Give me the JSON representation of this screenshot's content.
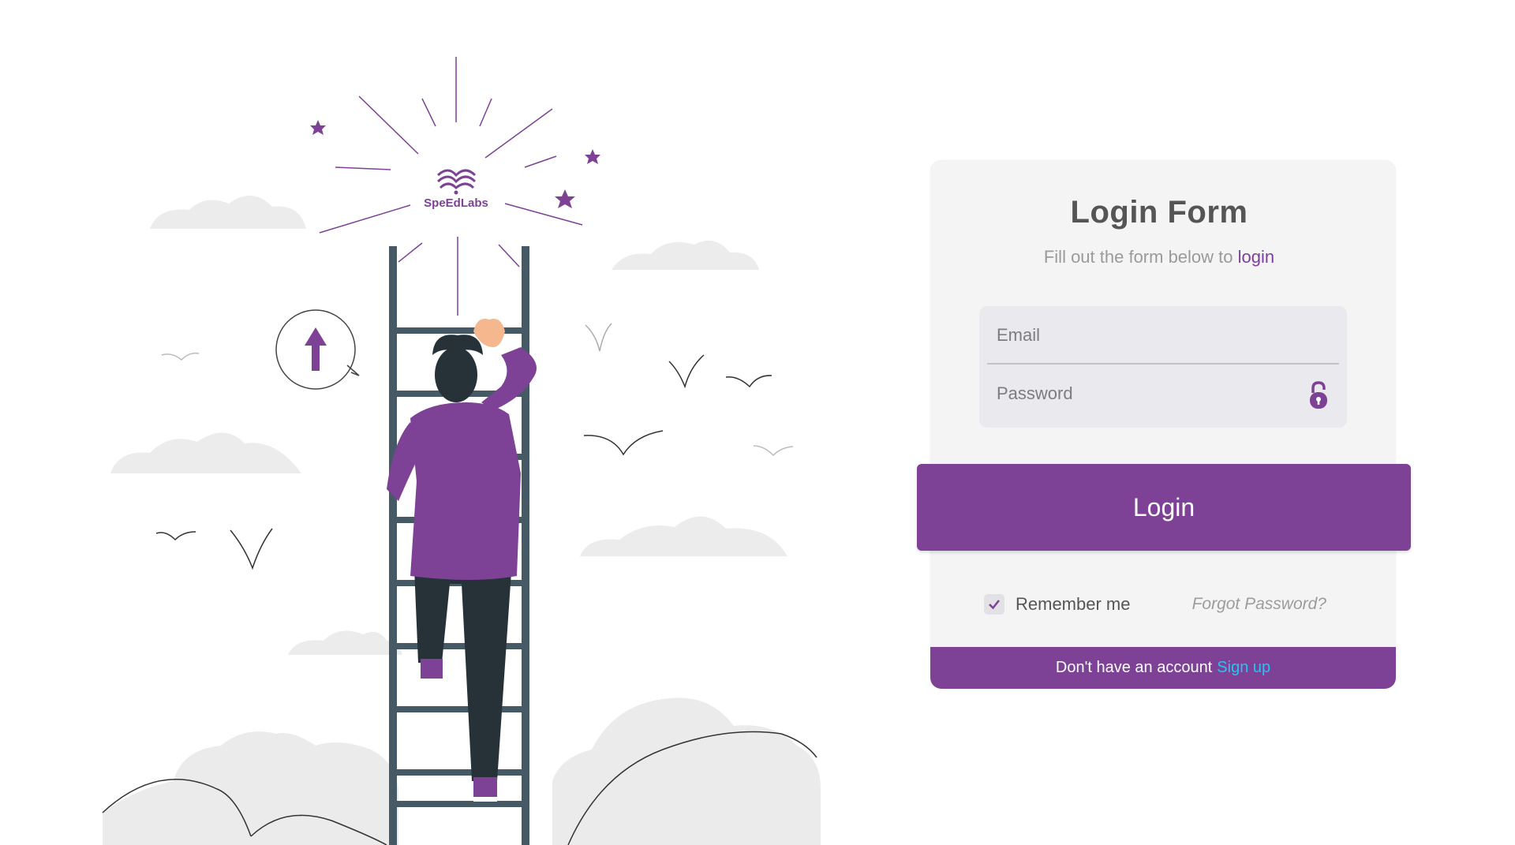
{
  "brand": {
    "logo_text": "SpeEdLabs",
    "accent_color": "#7d4196",
    "link_color": "#27c3f0"
  },
  "illustration": {
    "description_icons": [
      "speedlabs-logo-icon",
      "up-arrow-icon",
      "ladder",
      "bird-icon",
      "cloud-icon",
      "star-icon"
    ]
  },
  "form": {
    "title": "Login Form",
    "subtitle_prefix": "Fill out the form below to ",
    "subtitle_accent": "login",
    "email_placeholder": "Email",
    "password_placeholder": "Password",
    "login_button": "Login",
    "remember_label": "Remember me",
    "remember_checked": true,
    "forgot_link": "Forgot Password?",
    "footer_text": "Don't have an account",
    "signup_link": "Sign up"
  }
}
